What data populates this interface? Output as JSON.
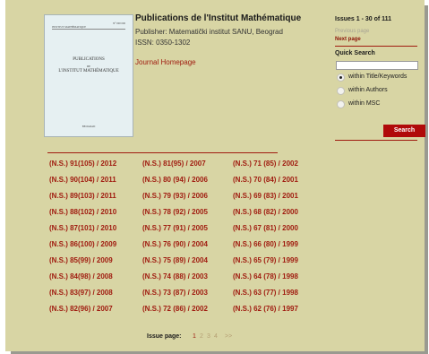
{
  "journal": {
    "title": "Publications de l'Institut Mathématique",
    "publisher": "Publisher: Matematički institut SANU, Beograd",
    "issn": "ISSN: 0350-1302",
    "homepage_link": "Journal Homepage"
  },
  "cover": {
    "top_left": "INSTITUT MATHÉMATIQUE",
    "top_right": "N° 000 000",
    "title_line1": "PUBLICATIONS",
    "title_de": "DE",
    "title_line2": "L'INSTITUT MATHÉMATIQUE",
    "bottom": "BEOGRAD"
  },
  "sidebar": {
    "issues_range": "Issues 1 - 30 of 111",
    "previous_page": "Previous page",
    "next_page": "Next page",
    "quick_search_title": "Quick Search",
    "search_value": "",
    "options": [
      {
        "label": "within Title/Keywords",
        "checked": true
      },
      {
        "label": "within Authors",
        "checked": false
      },
      {
        "label": "within MSC",
        "checked": false
      }
    ],
    "search_button": "Search"
  },
  "issues": [
    [
      "(N.S.) 91(105) / 2012",
      "(N.S.) 90(104) / 2011",
      "(N.S.) 89(103) / 2011",
      "(N.S.) 88(102) / 2010",
      "(N.S.) 87(101) / 2010",
      "(N.S.) 86(100) / 2009",
      "(N.S.) 85(99) / 2009",
      "(N.S.) 84(98) / 2008",
      "(N.S.) 83(97) / 2008",
      "(N.S.) 82(96) / 2007"
    ],
    [
      "(N.S.) 81(95) / 2007",
      "(N.S.) 80 (94) / 2006",
      "(N.S.) 79 (93) / 2006",
      "(N.S.) 78 (92) / 2005",
      "(N.S.) 77 (91) / 2005",
      "(N.S.) 76 (90) / 2004",
      "(N.S.) 75 (89) / 2004",
      "(N.S.) 74 (88) / 2003",
      "(N.S.) 73 (87) / 2003",
      "(N.S.) 72 (86) / 2002"
    ],
    [
      "(N.S.) 71 (85) / 2002",
      "(N.S.) 70 (84) / 2001",
      "(N.S.) 69 (83) / 2001",
      "(N.S.) 68 (82) / 2000",
      "(N.S.) 67 (81) / 2000",
      "(N.S.) 66 (80) / 1999",
      "(N.S.) 65 (79) / 1999",
      "(N.S.) 64 (78) / 1998",
      "(N.S.) 63 (77) / 1998",
      "(N.S.) 62 (76) / 1997"
    ]
  ],
  "pager": {
    "label": "Issue page:",
    "pages": [
      "1",
      "2",
      "3",
      "4"
    ],
    "current": "1",
    "next": ">>"
  },
  "colors": {
    "background": "#d8d5a4",
    "link": "#a01c10",
    "search_button": "#b00a0a"
  }
}
